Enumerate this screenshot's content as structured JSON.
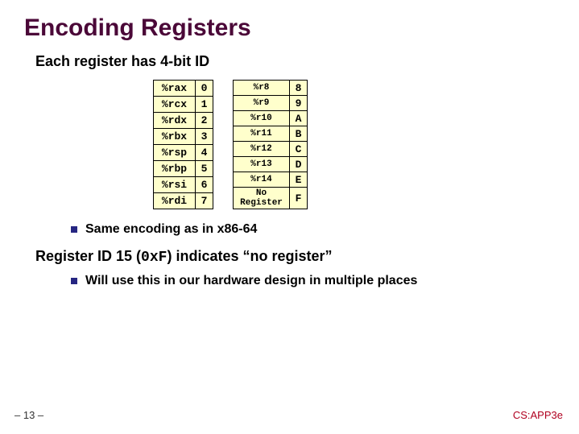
{
  "title": "Encoding Registers",
  "subhead": "Each register has 4-bit ID",
  "chart_data": {
    "type": "table",
    "title": "Register 4-bit ID encoding",
    "left": [
      {
        "reg": "%rax",
        "id": "0"
      },
      {
        "reg": "%rcx",
        "id": "1"
      },
      {
        "reg": "%rdx",
        "id": "2"
      },
      {
        "reg": "%rbx",
        "id": "3"
      },
      {
        "reg": "%rsp",
        "id": "4"
      },
      {
        "reg": "%rbp",
        "id": "5"
      },
      {
        "reg": "%rsi",
        "id": "6"
      },
      {
        "reg": "%rdi",
        "id": "7"
      }
    ],
    "right": [
      {
        "reg": "%r8",
        "id": "8"
      },
      {
        "reg": "%r9",
        "id": "9"
      },
      {
        "reg": "%r10",
        "id": "A"
      },
      {
        "reg": "%r11",
        "id": "B"
      },
      {
        "reg": "%r12",
        "id": "C"
      },
      {
        "reg": "%r13",
        "id": "D"
      },
      {
        "reg": "%r14",
        "id": "E"
      },
      {
        "reg": "No Register",
        "id": "F"
      }
    ]
  },
  "bullet1": "Same encoding as in x86-64",
  "heading2_pre": "Register ID 15 (",
  "heading2_code": "0xF",
  "heading2_post": ") indicates “no register”",
  "bullet2": "Will use this in our hardware design in multiple places",
  "footer_left": "– 13 –",
  "footer_right": "CS:APP3e"
}
